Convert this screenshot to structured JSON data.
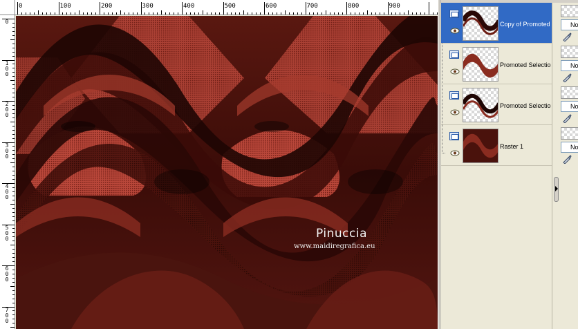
{
  "ruler": {
    "h_labels": [
      "0",
      "100",
      "200",
      "300",
      "400",
      "500",
      "600",
      "700",
      "800",
      "900"
    ],
    "v_labels": [
      "0",
      "100",
      "200",
      "300",
      "400",
      "500",
      "600",
      "700"
    ]
  },
  "watermark": {
    "name": "Pinuccia",
    "url": "www.maidiregrafica.eu"
  },
  "layers": [
    {
      "name": "Copy of Promoted",
      "selected": true
    },
    {
      "name": "Promoted Selectio",
      "selected": false
    },
    {
      "name": "Promoted Selectio",
      "selected": false
    },
    {
      "name": "Raster 1",
      "selected": false
    }
  ],
  "props": {
    "blend_mode": "No"
  },
  "colors": {
    "canvas_dark": "#2a0a06",
    "canvas_mid": "#6e1f16",
    "canvas_light": "#c0503e",
    "selection": "#316ac5"
  }
}
